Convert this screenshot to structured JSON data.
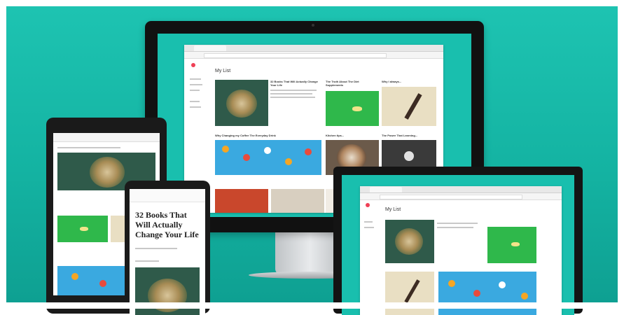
{
  "imac_screen": {
    "heading": "My List",
    "cards": [
      {
        "title": "32 Books That Will Actually Change Your Life"
      },
      {
        "title": "The Truth About The Diet Supplements"
      },
      {
        "title": "Why I always..."
      },
      {
        "title": "Why Changing my Coffee The Everyday Drink"
      },
      {
        "title": "Kitchen tips..."
      },
      {
        "title": "The Power That Learning..."
      }
    ]
  },
  "phone_screen": {
    "title": "32 Books That Will Actually Change Your Life"
  },
  "monitor_screen": {
    "heading": "My List"
  },
  "colors": {
    "background": "#19bfae",
    "accent": "#ef4056"
  }
}
